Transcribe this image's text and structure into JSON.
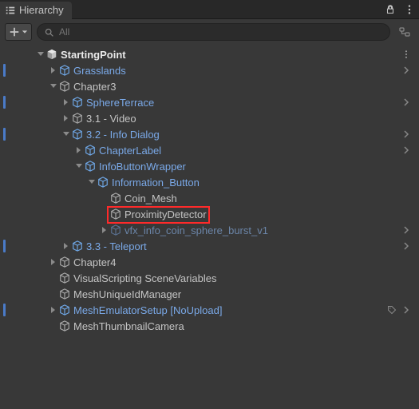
{
  "tab": {
    "title": "Hierarchy"
  },
  "toolbar": {
    "search_placeholder": "All"
  },
  "colors": {
    "prefab": "#7aa9e8",
    "text": "#c4c4c4",
    "muted": "#6b85a8"
  },
  "icons": {
    "list": "list-icon",
    "lock": "lock-icon",
    "more": "more-icon",
    "plus": "plus-icon",
    "dropdown": "dropdown-icon",
    "search": "search-icon",
    "family": "family-icon",
    "scene": "scene-cube-icon",
    "cube_pref": "prefab-cube-icon",
    "cube_go": "gameobject-cube-icon",
    "tri_down": "triangle-down-icon",
    "tri_right": "triangle-right-icon",
    "chev_right": "chevron-right-icon",
    "tag": "tag-icon",
    "kebab": "kebab-icon"
  },
  "tree": [
    {
      "depth": 0,
      "label": "StartingPoint",
      "type": "scene",
      "expand": "down",
      "bar": false,
      "right": "kebab"
    },
    {
      "depth": 1,
      "label": "Grasslands",
      "type": "prefab",
      "expand": "right",
      "bar": true,
      "right": "chev"
    },
    {
      "depth": 1,
      "label": "Chapter3",
      "type": "go",
      "expand": "down",
      "bar": false,
      "right": null
    },
    {
      "depth": 2,
      "label": "SphereTerrace",
      "type": "prefab",
      "expand": "right",
      "bar": true,
      "right": "chev"
    },
    {
      "depth": 2,
      "label": "3.1 - Video",
      "type": "go",
      "expand": "right",
      "bar": false,
      "right": null
    },
    {
      "depth": 2,
      "label": "3.2 - Info Dialog",
      "type": "prefab",
      "expand": "down",
      "bar": true,
      "right": "chev"
    },
    {
      "depth": 3,
      "label": "ChapterLabel",
      "type": "prefab",
      "expand": "right",
      "bar": false,
      "right": "chev"
    },
    {
      "depth": 3,
      "label": "InfoButtonWrapper",
      "type": "prefab",
      "expand": "down",
      "bar": false,
      "right": null
    },
    {
      "depth": 4,
      "label": "Information_Button",
      "type": "prefab",
      "expand": "down",
      "bar": false,
      "right": null
    },
    {
      "depth": 5,
      "label": "Coin_Mesh",
      "type": "go",
      "expand": "none",
      "bar": false,
      "right": null
    },
    {
      "depth": 5,
      "label": "ProximityDetector",
      "type": "go",
      "expand": "none",
      "bar": false,
      "right": null,
      "highlight": true
    },
    {
      "depth": 5,
      "label": "vfx_info_coin_sphere_burst_v1",
      "type": "muted",
      "expand": "right",
      "bar": false,
      "right": "chev"
    },
    {
      "depth": 2,
      "label": "3.3 - Teleport",
      "type": "prefab",
      "expand": "right",
      "bar": true,
      "right": "chev"
    },
    {
      "depth": 1,
      "label": "Chapter4",
      "type": "go",
      "expand": "right",
      "bar": false,
      "right": null
    },
    {
      "depth": 1,
      "label": "VisualScripting SceneVariables",
      "type": "go",
      "expand": "none",
      "bar": false,
      "right": null
    },
    {
      "depth": 1,
      "label": "MeshUniqueIdManager",
      "type": "go",
      "expand": "none",
      "bar": false,
      "right": null
    },
    {
      "depth": 1,
      "label": "MeshEmulatorSetup [NoUpload]",
      "type": "prefab",
      "expand": "right",
      "bar": true,
      "right": "tagchev"
    },
    {
      "depth": 1,
      "label": "MeshThumbnailCamera",
      "type": "go",
      "expand": "none",
      "bar": false,
      "right": null
    }
  ]
}
